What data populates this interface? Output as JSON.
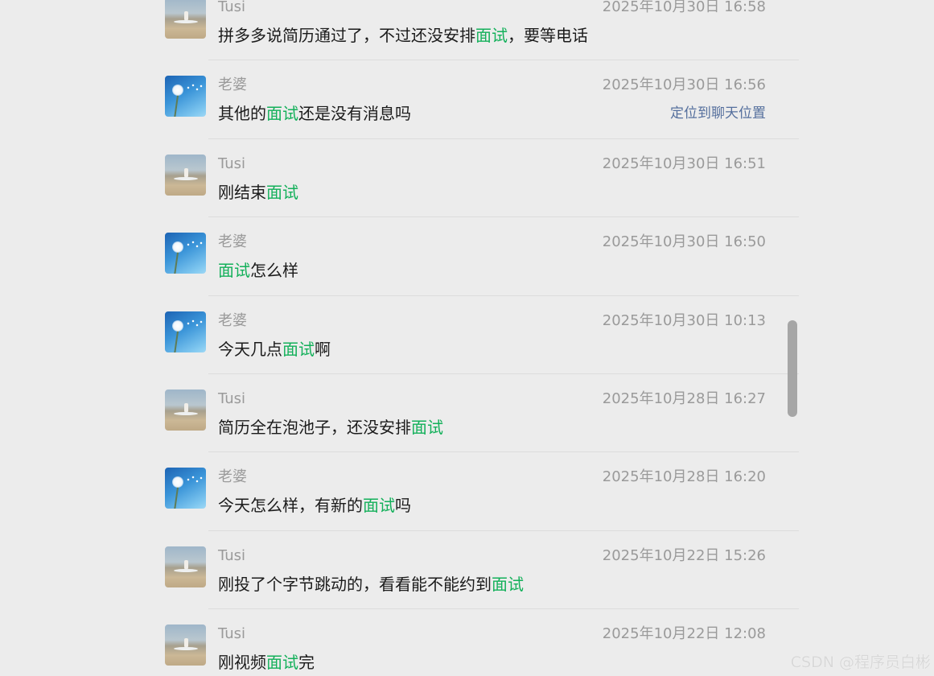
{
  "messages": [
    {
      "sender": "Tusi",
      "avatar": "beach-photo-avatar",
      "time": "2025年10月30日 16:58",
      "parts": [
        {
          "t": "拼多多说简历通过了，不过还没安排"
        },
        {
          "t": "面试",
          "hl": true
        },
        {
          "t": "，要等电话"
        }
      ]
    },
    {
      "sender": "老婆",
      "avatar": "dandelion-avatar",
      "time": "2025年10月30日 16:56",
      "locate": "定位到聊天位置",
      "parts": [
        {
          "t": "其他的"
        },
        {
          "t": "面试",
          "hl": true
        },
        {
          "t": "还是没有消息吗"
        }
      ]
    },
    {
      "sender": "Tusi",
      "avatar": "beach-photo-avatar",
      "time": "2025年10月30日 16:51",
      "parts": [
        {
          "t": "刚结束"
        },
        {
          "t": "面试",
          "hl": true
        }
      ]
    },
    {
      "sender": "老婆",
      "avatar": "dandelion-avatar",
      "time": "2025年10月30日 16:50",
      "parts": [
        {
          "t": "面试",
          "hl": true
        },
        {
          "t": "怎么样"
        }
      ]
    },
    {
      "sender": "老婆",
      "avatar": "dandelion-avatar",
      "time": "2025年10月30日 10:13",
      "parts": [
        {
          "t": "今天几点"
        },
        {
          "t": "面试",
          "hl": true
        },
        {
          "t": "啊"
        }
      ]
    },
    {
      "sender": "Tusi",
      "avatar": "beach-photo-avatar",
      "time": "2025年10月28日 16:27",
      "parts": [
        {
          "t": "简历全在泡池子，还没安排"
        },
        {
          "t": "面试",
          "hl": true
        }
      ]
    },
    {
      "sender": "老婆",
      "avatar": "dandelion-avatar",
      "time": "2025年10月28日 16:20",
      "parts": [
        {
          "t": "今天怎么样，有新的"
        },
        {
          "t": "面试",
          "hl": true
        },
        {
          "t": "吗"
        }
      ]
    },
    {
      "sender": "Tusi",
      "avatar": "beach-photo-avatar",
      "time": "2025年10月22日 15:26",
      "parts": [
        {
          "t": "刚投了个字节跳动的，看看能不能约到"
        },
        {
          "t": "面试",
          "hl": true
        }
      ]
    },
    {
      "sender": "Tusi",
      "avatar": "beach-photo-avatar",
      "time": "2025年10月22日 12:08",
      "parts": [
        {
          "t": "刚视频"
        },
        {
          "t": "面试",
          "hl": true
        },
        {
          "t": "完"
        }
      ]
    }
  ],
  "colors": {
    "background": "#ececec",
    "highlight": "#13b05a",
    "meta_text": "#9a9a9a",
    "link": "#556f9d"
  },
  "watermark": "CSDN @程序员白彬"
}
